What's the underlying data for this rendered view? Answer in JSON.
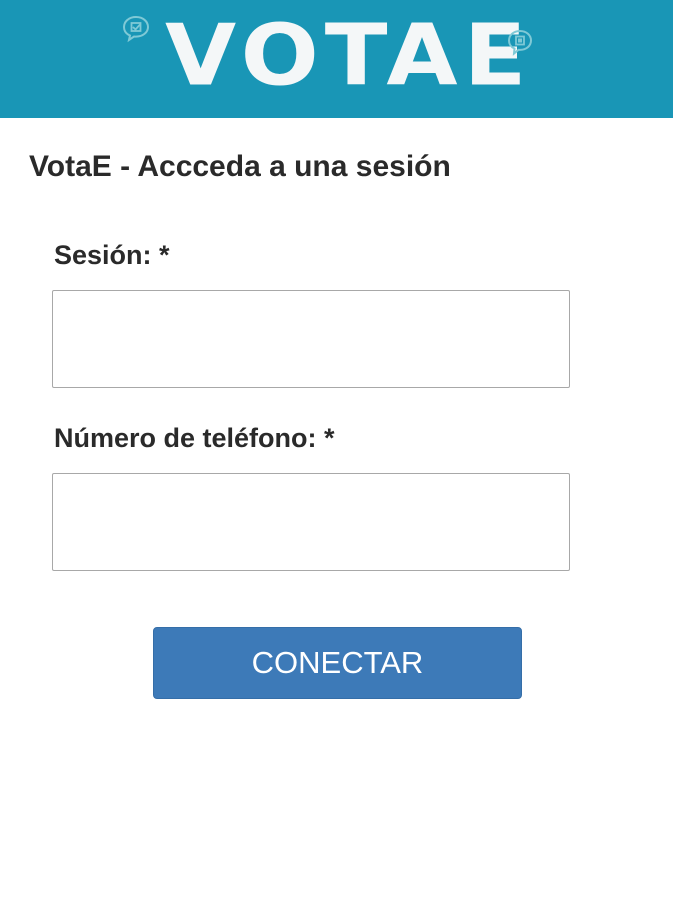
{
  "header": {
    "logo_text": "VOTAE",
    "brand_color": "#1996b6",
    "left_icon": "chat-check-icon",
    "right_icon": "chat-square-icon"
  },
  "page": {
    "title": "VotaE - Accceda a una sesión"
  },
  "form": {
    "session_label": "Sesión: *",
    "session_value": "",
    "session_placeholder": "",
    "phone_label": "Número de teléfono: *",
    "phone_value": "",
    "phone_placeholder": "",
    "submit_label": "CONECTAR",
    "submit_color": "#3d7ab8"
  }
}
